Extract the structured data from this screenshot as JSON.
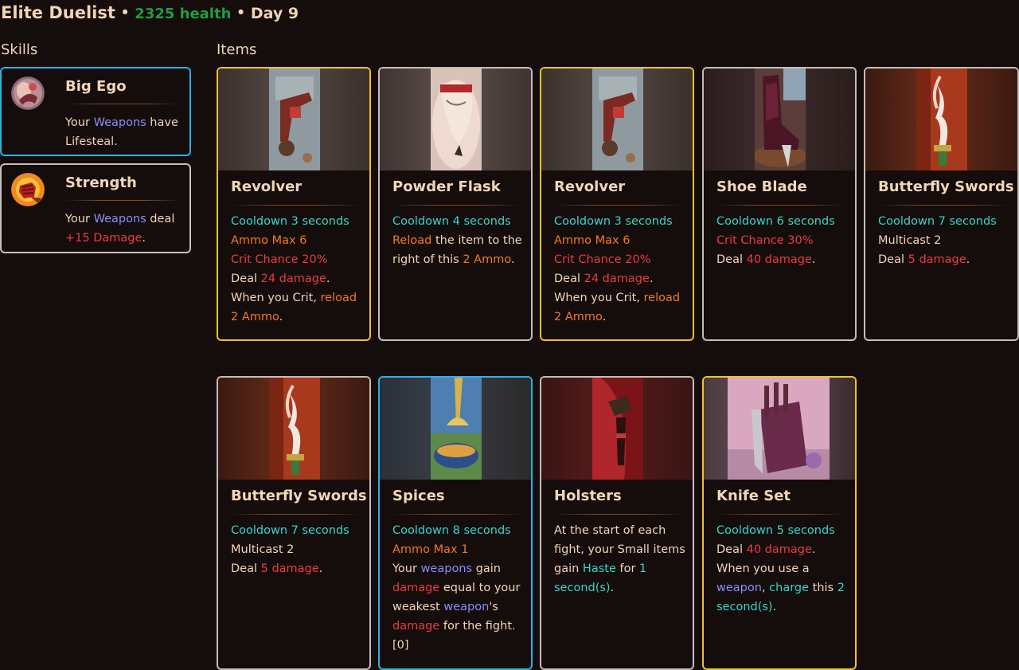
{
  "header": {
    "name": "Elite Duelist",
    "separator": "•",
    "health": "2325 health",
    "day": "Day 9"
  },
  "sections": {
    "skills": "Skills",
    "items": "Items"
  },
  "colors": {
    "background": "#150c0c",
    "text": "#f1d7b7",
    "health": "#1f9e3e",
    "cooldown": "#34d7c9",
    "ammo": "#f07a25",
    "damage": "#eb3d3d",
    "weapon": "#8a8dff",
    "border_gold": "#f2c131",
    "border_blue": "#2bb1e6",
    "border_silver": "#c6bdba"
  },
  "skills": [
    {
      "title": "Big Ego",
      "icon": "big-ego-icon",
      "line1_a": "Your ",
      "line1_b": "Weapons",
      "line1_c": " have",
      "line2_a": "Lifesteal."
    },
    {
      "title": "Strength",
      "icon": "strength-fist-icon",
      "line1_a": "Your ",
      "line1_b": "Weapons",
      "line1_c": " deal",
      "line2_a": "+15 Damage",
      "line2_b": "."
    }
  ],
  "items": [
    {
      "title": "Revolver",
      "tier": "gold",
      "icon": "revolver-icon",
      "cooldown": "Cooldown 3 seconds",
      "ammo": "Ammo Max 6",
      "crit": "Crit Chance 20%",
      "deal_a": "Deal ",
      "deal_b": "24 damage",
      "deal_c": ".",
      "crit_a": "When you Crit, ",
      "crit_b": "reload",
      "crit_c": "2 Ammo",
      "crit_d": "."
    },
    {
      "title": "Powder Flask",
      "tier": "silver",
      "icon": "powder-horn-icon",
      "cooldown": "Cooldown 4 seconds",
      "reload_a": "Reload",
      "reload_b": " the item to the",
      "reload_c": "right of this ",
      "reload_d": "2 Ammo",
      "reload_e": "."
    },
    {
      "title": "Revolver",
      "tier": "gold",
      "icon": "revolver-icon",
      "cooldown": "Cooldown 3 seconds",
      "ammo": "Ammo Max 6",
      "crit": "Crit Chance 20%",
      "deal_a": "Deal ",
      "deal_b": "24 damage",
      "deal_c": ".",
      "crit_a": "When you Crit, ",
      "crit_b": "reload",
      "crit_c": "2 Ammo",
      "crit_d": "."
    },
    {
      "title": "Shoe Blade",
      "tier": "silver",
      "icon": "boot-blade-icon",
      "cooldown": "Cooldown 6 seconds",
      "crit": "Crit Chance 30%",
      "deal_a": "Deal ",
      "deal_b": "40 damage",
      "deal_c": "."
    },
    {
      "title": "Butterfly Swords",
      "tier": "silver",
      "icon": "butterfly-swords-icon",
      "cooldown": "Cooldown 7 seconds",
      "multicast": "Multicast 2",
      "deal_a": "Deal ",
      "deal_b": "5 damage",
      "deal_c": "."
    },
    {
      "title": "Butterfly Swords",
      "tier": "silver",
      "icon": "butterfly-swords-icon",
      "cooldown": "Cooldown 7 seconds",
      "multicast": "Multicast 2",
      "deal_a": "Deal ",
      "deal_b": "5 damage",
      "deal_c": "."
    },
    {
      "title": "Spices",
      "tier": "blue",
      "icon": "spices-bowl-icon",
      "cooldown": "Cooldown 8 seconds",
      "ammo": "Ammo Max 1",
      "t1_a": "Your ",
      "t1_b": "weapons",
      "t1_c": " gain",
      "t2_a": "damage",
      "t2_b": " equal to your",
      "t3_a": "weakest ",
      "t3_b": "weapon",
      "t3_c": "'s",
      "t4_a": "damage",
      "t4_b": " for the fight.",
      "t5_a": "[0]"
    },
    {
      "title": "Holsters",
      "tier": "silver",
      "icon": "holster-icon",
      "t1_a": "At the start of each",
      "t2_a": "fight, your Small items",
      "t3_a": "gain ",
      "t3_b": "Haste",
      "t3_c": " for ",
      "t3_d": "1",
      "t4_a": "second(s)",
      "t4_b": "."
    },
    {
      "title": "Knife Set",
      "tier": "gold",
      "icon": "knife-block-icon",
      "cooldown": "Cooldown 5 seconds",
      "deal_a": "Deal ",
      "deal_b": "40 damage",
      "deal_c": ".",
      "t1_a": "When you use a",
      "t2_a": "weapon",
      "t2_b": ", ",
      "t2_c": "charge",
      "t2_d": " this ",
      "t2_e": "2",
      "t3_a": "second(s)",
      "t3_b": "."
    }
  ]
}
